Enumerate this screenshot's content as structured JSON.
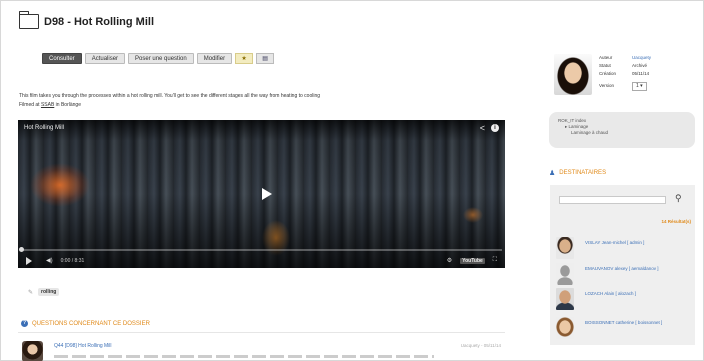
{
  "header": {
    "title": "D98 - Hot Rolling Mill"
  },
  "toolbar": {
    "consult_label": "Consulter",
    "refresh_label": "Actualiser",
    "ask_label": "Poser une question",
    "edit_label": "Modifier"
  },
  "description": {
    "line1": "This film takes you through the processes within a hot rolling mill. You'll get to see the different stages all the way from heating to cooling",
    "filmed_prefix": "Filmed at ",
    "filmed_link": "SSAB",
    "filmed_suffix": " in Borlänge"
  },
  "video": {
    "title": "Hot Rolling Mill",
    "time": "0:00 / 8:31",
    "progress_fraction": 0,
    "yt_label": "YouTube"
  },
  "tags": [
    "rolling"
  ],
  "questions": {
    "section_title": "QUESTIONS CONCERNANT CE DOSSIER",
    "items": [
      {
        "title": "Q44 [D98] Hot Rolling Mill",
        "meta": "Uacquety - 05/11/14"
      }
    ]
  },
  "meta": {
    "author_k": "Auteur",
    "author_v": "Uacquety",
    "status_k": "Statut",
    "status_v": "Archivé",
    "created_k": "Création",
    "created_v": "05/11/14",
    "version_k": "Version",
    "version_v": "1 ▾"
  },
  "tree": {
    "root": "ROK_IT index",
    "level2": "Laminage",
    "level3": "Laminage à chaud"
  },
  "recipients": {
    "title": "DESTINATAIRES",
    "search_placeholder": "",
    "count": "14 Résultat(s)",
    "people": [
      {
        "name": "VISLAY Jean-michel [ admin ]",
        "color": "#6a5040"
      },
      {
        "name": "EMAUVANOV alexey [ aemaldanov ]",
        "color": "#c9c9c9"
      },
      {
        "name": "LOZACH Alain [ alozach ]",
        "color": "#5d4a3d"
      },
      {
        "name": "BOISSONNET catherine [ boissonnet ]",
        "color": "#c28f65"
      }
    ]
  }
}
